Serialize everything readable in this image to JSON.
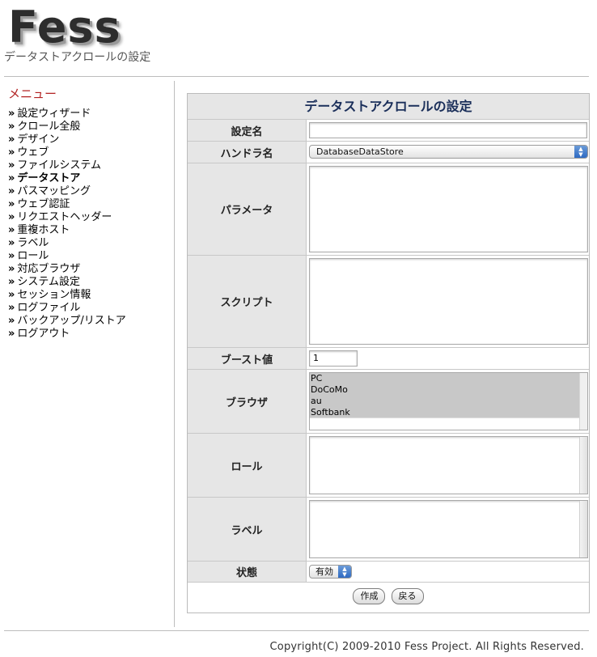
{
  "header": {
    "logo": "Fess",
    "subtitle": "データストアクロールの設定"
  },
  "menu": {
    "title": "メニュー",
    "bullet": "»",
    "items": [
      {
        "label": "設定ウィザード"
      },
      {
        "label": "クロール全般"
      },
      {
        "label": "デザイン"
      },
      {
        "label": "ウェブ"
      },
      {
        "label": "ファイルシステム"
      },
      {
        "label": "データストア"
      },
      {
        "label": "パスマッピング"
      },
      {
        "label": "ウェブ認証"
      },
      {
        "label": "リクエストヘッダー"
      },
      {
        "label": "重複ホスト"
      },
      {
        "label": "ラベル"
      },
      {
        "label": "ロール"
      },
      {
        "label": "対応ブラウザ"
      },
      {
        "label": "システム設定"
      },
      {
        "label": "セッション情報"
      },
      {
        "label": "ログファイル"
      },
      {
        "label": "バックアップ/リストア"
      },
      {
        "label": "ログアウト"
      }
    ]
  },
  "form": {
    "title": "データストアクロールの設定",
    "name_label": "設定名",
    "name_value": "",
    "handler_label": "ハンドラ名",
    "handler_value": "DatabaseDataStore",
    "params_label": "パラメータ",
    "script_label": "スクリプト",
    "boost_label": "ブースト値",
    "boost_value": "1",
    "browser_label": "ブラウザ",
    "browser_options": [
      "PC",
      "DoCoMo",
      "au",
      "Softbank"
    ],
    "role_label": "ロール",
    "labels_label": "ラベル",
    "status_label": "状態",
    "status_value": "有効",
    "create_button": "作成",
    "back_button": "戻る"
  },
  "footer": {
    "copyright": "Copyright(C) 2009-2010 Fess Project. All Rights Reserved."
  }
}
